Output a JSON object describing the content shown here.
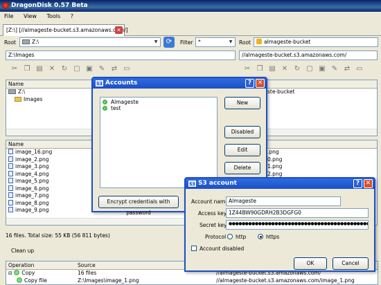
{
  "window": {
    "title": "DragonDisk 0.57 Beta"
  },
  "menu": [
    "File",
    "View",
    "Tools",
    "?"
  ],
  "tab": {
    "label": "[Z:\\] [//almageste-bucket.s3.amazonaws.com/]"
  },
  "left": {
    "root_label": "Root",
    "root_value": "Z:\\",
    "path": "Z:\\Images",
    "tree_header": "Name",
    "tree": [
      "Z:\\",
      "Images"
    ],
    "files_header": "Name",
    "files": [
      "image_16.png",
      "image_2.png",
      "image_3.png",
      "image_4.png",
      "image_5.png",
      "image_6.png",
      "image_7.png",
      "image_8.png",
      "image_9.png"
    ],
    "status": "16 files. Total size: 55 KB (56 811 bytes)"
  },
  "right": {
    "filter_label": "Filter",
    "filter_value": "*",
    "root_label": "Root",
    "root_value": "almageste-bucket",
    "path": "//almageste-bucket.s3.amazonaws.com/",
    "tree_partial": "ste-bucket",
    "files_partial": [
      ".png",
      "0.png",
      "1.png",
      "2.png",
      "3.png",
      "4.png"
    ]
  },
  "accounts": {
    "title": "Accounts",
    "items": [
      "Almageste",
      "test"
    ],
    "new_label": "New",
    "disabled_label": "Disabled",
    "edit_label": "Edit",
    "delete_label": "Delete",
    "encrypt_label": "Encrypt credentials with password"
  },
  "s3": {
    "title": "S3 account",
    "account_name_label": "Account name",
    "account_name": "Almageste",
    "access_key_label": "Access key",
    "access_key": "1Z44BW90GDRH2B3DGFG0",
    "secret_key_label": "Secret key",
    "secret_key": "●●●●●●●●●●●●●●●●●●●●●●●●●●●●●●●●●●●●●●●●●●●●●●●",
    "protocol_label": "Protocol",
    "http_label": "http",
    "https_label": "https",
    "disabled_label": "Account disabled",
    "ok_label": "OK",
    "cancel_label": "Cancel"
  },
  "queue": {
    "cleanup_label": "Clean up",
    "col_operation": "Operation",
    "col_source": "Source",
    "rows": [
      {
        "op": "Copy",
        "src": "16 files",
        "dst": "//almageste-bucket.s3.amazonaws.com/"
      },
      {
        "op": "Copy file",
        "src": "Z:\\Images\\image_1.png",
        "dst": "//almageste-bucket.s3.amazonaws.com/image_1.png"
      }
    ]
  }
}
